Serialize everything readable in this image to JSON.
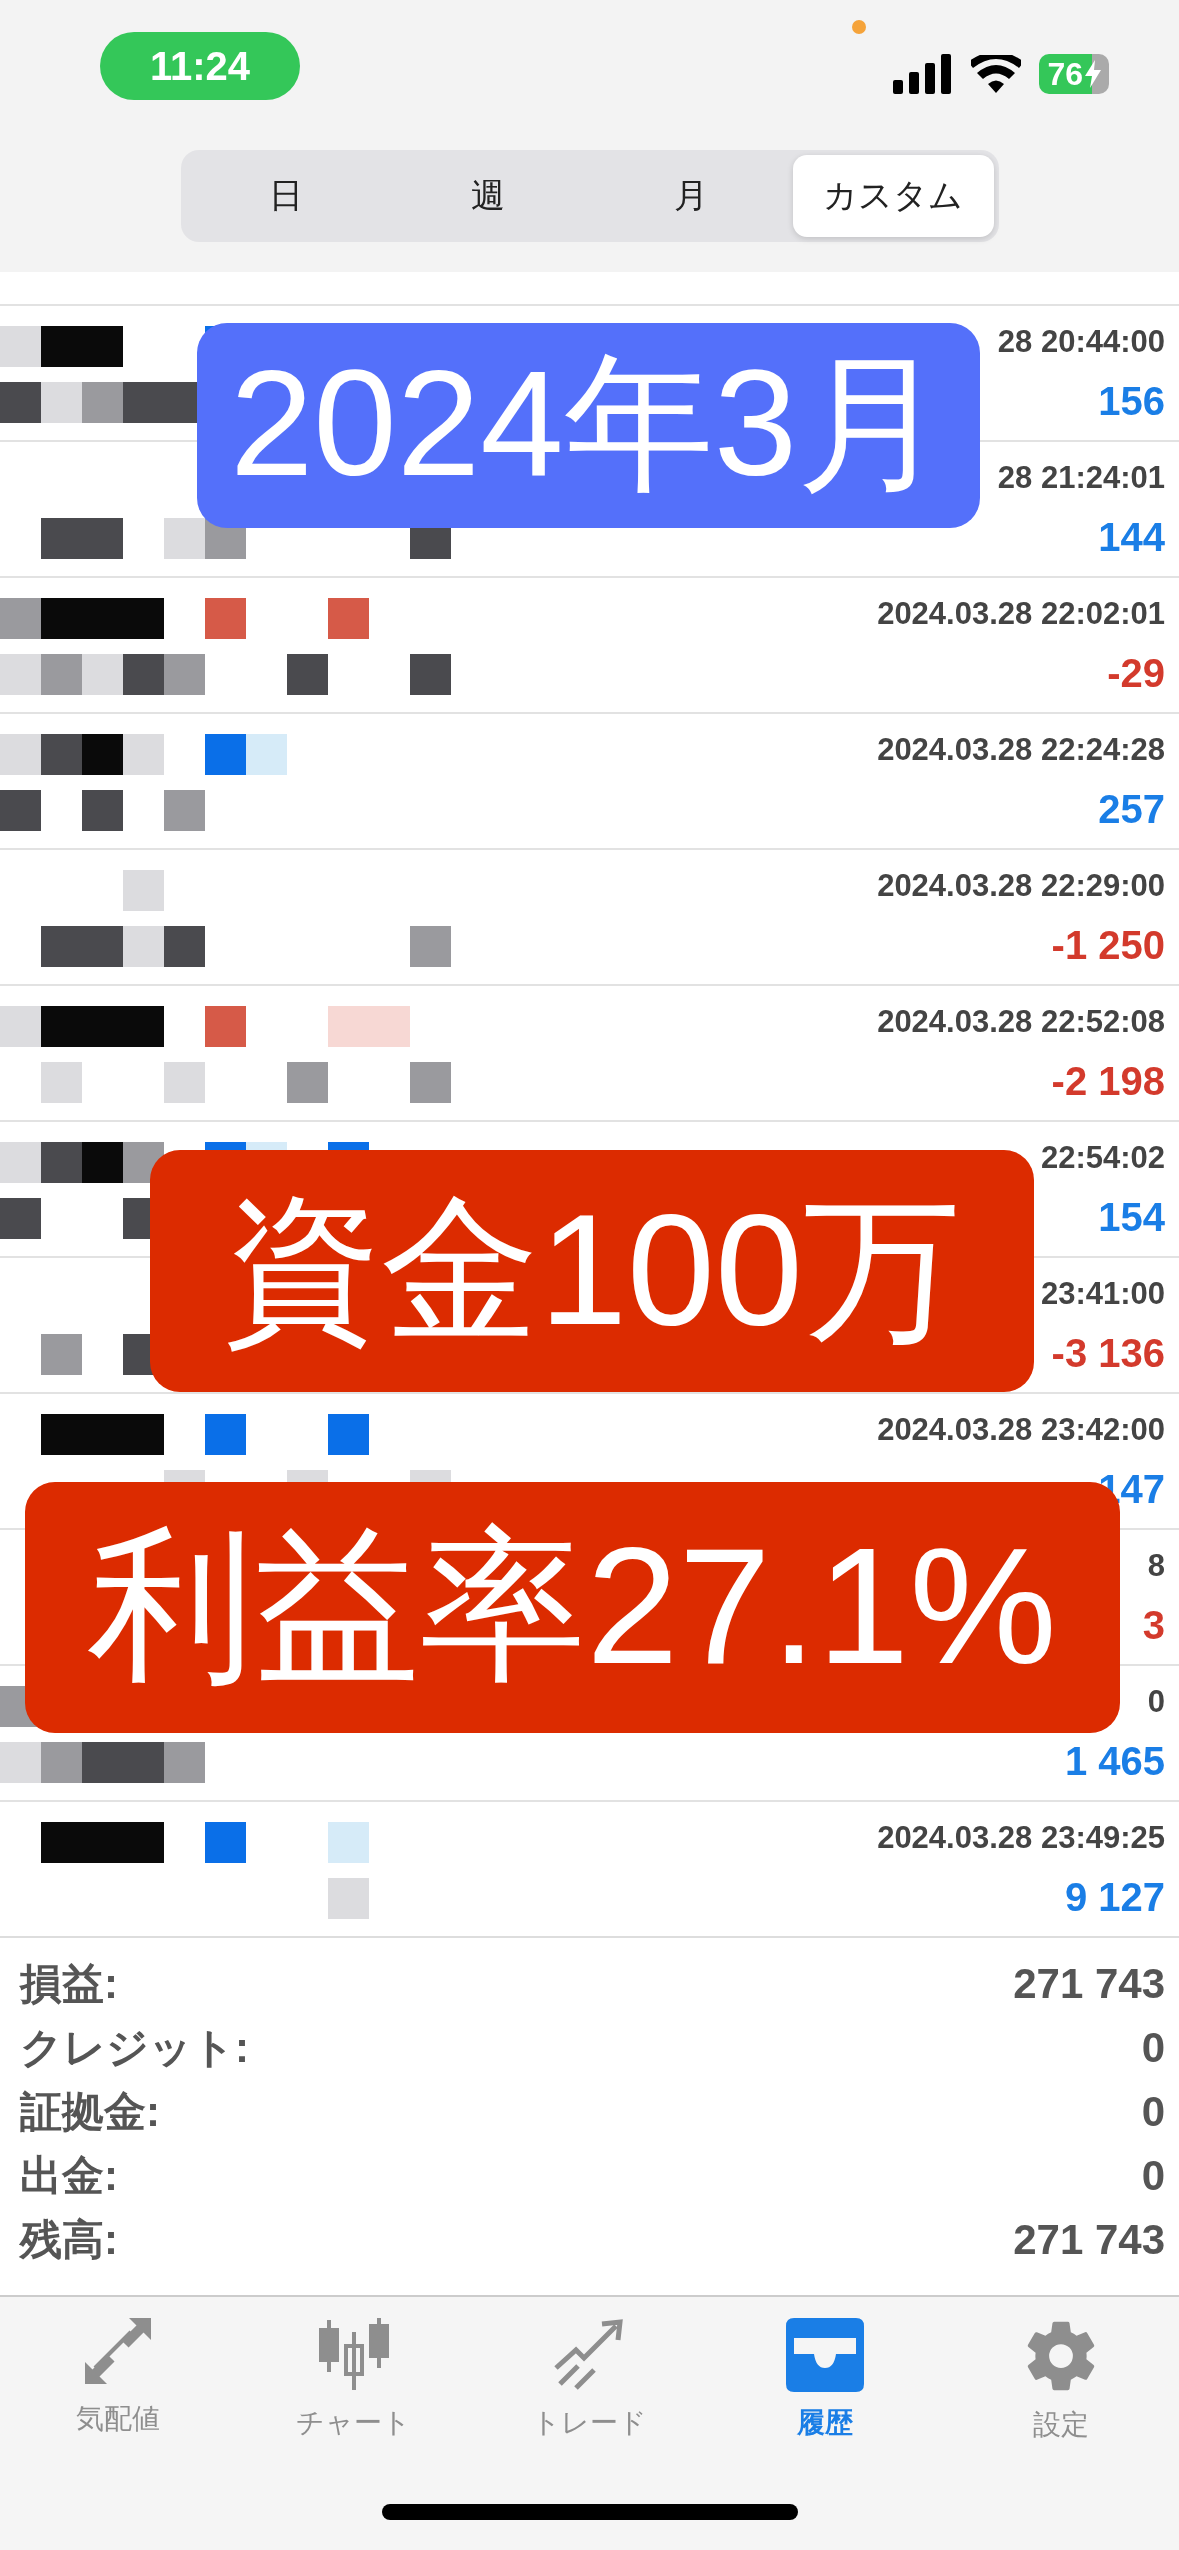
{
  "status_bar": {
    "time": "11:24",
    "battery": "76"
  },
  "period_tabs": [
    {
      "label": "日",
      "selected": false
    },
    {
      "label": "週",
      "selected": false
    },
    {
      "label": "月",
      "selected": false
    },
    {
      "label": "カスタム",
      "selected": true
    }
  ],
  "deals": [
    {
      "time": "28 20:44:00",
      "profit": "156",
      "loss": false
    },
    {
      "time": "28 21:24:01",
      "profit": "144",
      "loss": false
    },
    {
      "time": "2024.03.28 22:02:01",
      "profit": "-29",
      "loss": true
    },
    {
      "time": "2024.03.28 22:24:28",
      "profit": "257",
      "loss": false
    },
    {
      "time": "2024.03.28 22:29:00",
      "profit": "-1 250",
      "loss": true
    },
    {
      "time": "2024.03.28 22:52:08",
      "profit": "-2 198",
      "loss": true
    },
    {
      "time": "22:54:02",
      "profit": "154",
      "loss": false
    },
    {
      "time": "23:41:00",
      "profit": "-3 136",
      "loss": true
    },
    {
      "time": "2024.03.28 23:42:00",
      "profit": "147",
      "loss": false
    },
    {
      "time": "8",
      "profit": "3",
      "loss": true
    },
    {
      "time": "0",
      "profit": "1 465",
      "loss": false
    },
    {
      "time": "2024.03.28 23:49:25",
      "profit": "9 127",
      "loss": false
    }
  ],
  "summary": [
    {
      "label": "損益:",
      "value": "271 743"
    },
    {
      "label": "クレジット:",
      "value": "0"
    },
    {
      "label": "証拠金:",
      "value": "0"
    },
    {
      "label": "出金:",
      "value": "0"
    },
    {
      "label": "残高:",
      "value": "271 743"
    }
  ],
  "overlays": [
    {
      "text": "2024年3月",
      "kind": "blue"
    },
    {
      "text": "資金100万",
      "kind": "red"
    },
    {
      "text": "利益率27.1%",
      "kind": "red"
    }
  ],
  "tab_bar": [
    {
      "label": "気配値",
      "kind": "quotes",
      "selected": false
    },
    {
      "label": "チャート",
      "kind": "chart",
      "selected": false
    },
    {
      "label": "トレード",
      "kind": "trade",
      "selected": false
    },
    {
      "label": "履歴",
      "kind": "history",
      "selected": true
    },
    {
      "label": "設定",
      "kind": "settings",
      "selected": false
    }
  ]
}
